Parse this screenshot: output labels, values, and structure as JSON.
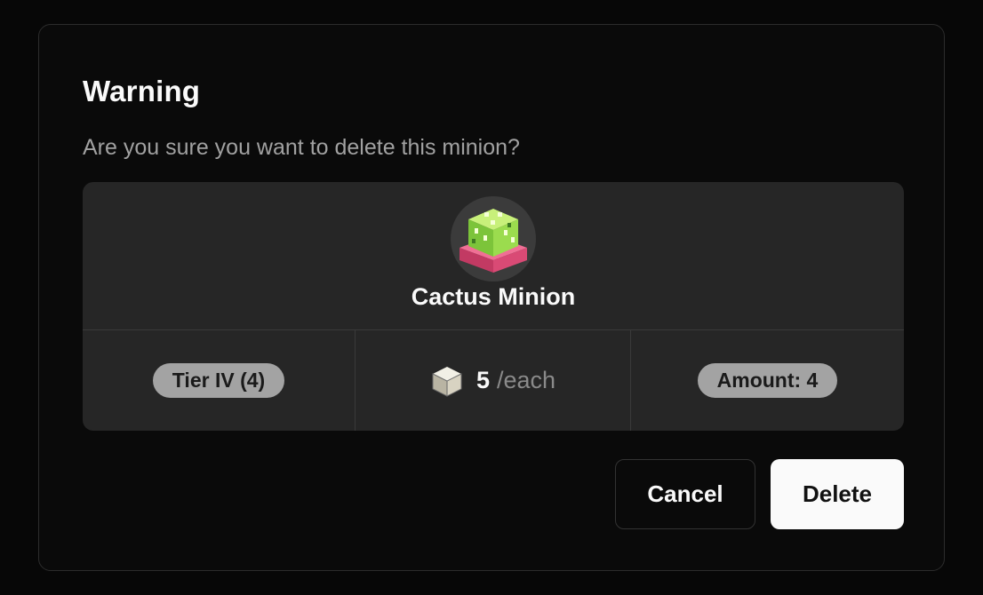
{
  "dialog": {
    "title": "Warning",
    "description": "Are you sure you want to delete this minion?"
  },
  "minion": {
    "name": "Cactus Minion",
    "icon": "cactus-minion-icon",
    "tier_label": "Tier IV (4)",
    "price_icon": "block-icon",
    "price_value": "5",
    "price_unit": "/each",
    "amount_label": "Amount: 4"
  },
  "actions": {
    "cancel_label": "Cancel",
    "delete_label": "Delete"
  },
  "colors": {
    "background": "#0a0a0a",
    "card": "#262626",
    "pill": "#a3a3a3",
    "primary_button": "#fafafa"
  }
}
